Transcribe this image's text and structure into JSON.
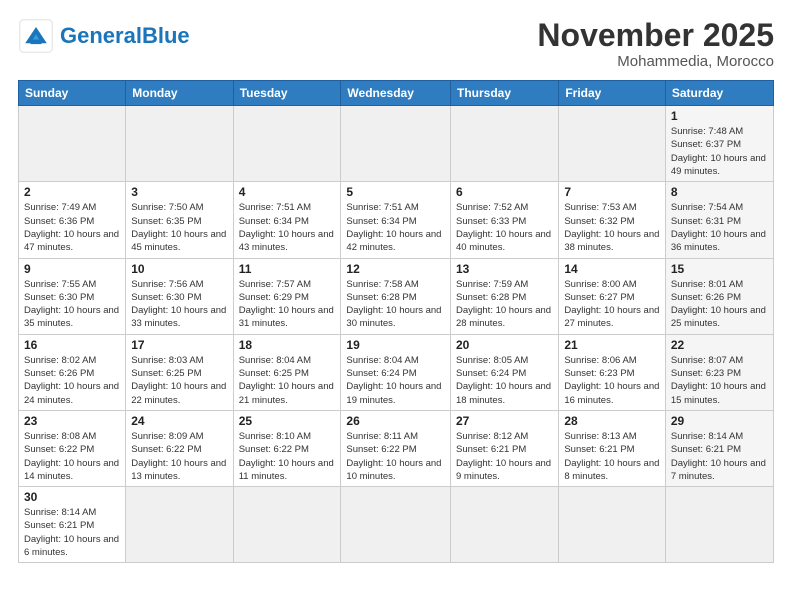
{
  "header": {
    "logo_general": "General",
    "logo_blue": "Blue",
    "month": "November 2025",
    "location": "Mohammedia, Morocco"
  },
  "days_of_week": [
    "Sunday",
    "Monday",
    "Tuesday",
    "Wednesday",
    "Thursday",
    "Friday",
    "Saturday"
  ],
  "weeks": [
    [
      {
        "num": "",
        "info": "",
        "empty": true
      },
      {
        "num": "",
        "info": "",
        "empty": true
      },
      {
        "num": "",
        "info": "",
        "empty": true
      },
      {
        "num": "",
        "info": "",
        "empty": true
      },
      {
        "num": "",
        "info": "",
        "empty": true
      },
      {
        "num": "",
        "info": "",
        "empty": true
      },
      {
        "num": "1",
        "info": "Sunrise: 7:48 AM\nSunset: 6:37 PM\nDaylight: 10 hours\nand 49 minutes.",
        "shaded": true
      }
    ],
    [
      {
        "num": "2",
        "info": "Sunrise: 7:49 AM\nSunset: 6:36 PM\nDaylight: 10 hours\nand 47 minutes."
      },
      {
        "num": "3",
        "info": "Sunrise: 7:50 AM\nSunset: 6:35 PM\nDaylight: 10 hours\nand 45 minutes."
      },
      {
        "num": "4",
        "info": "Sunrise: 7:51 AM\nSunset: 6:34 PM\nDaylight: 10 hours\nand 43 minutes."
      },
      {
        "num": "5",
        "info": "Sunrise: 7:51 AM\nSunset: 6:34 PM\nDaylight: 10 hours\nand 42 minutes."
      },
      {
        "num": "6",
        "info": "Sunrise: 7:52 AM\nSunset: 6:33 PM\nDaylight: 10 hours\nand 40 minutes."
      },
      {
        "num": "7",
        "info": "Sunrise: 7:53 AM\nSunset: 6:32 PM\nDaylight: 10 hours\nand 38 minutes."
      },
      {
        "num": "8",
        "info": "Sunrise: 7:54 AM\nSunset: 6:31 PM\nDaylight: 10 hours\nand 36 minutes.",
        "shaded": true
      }
    ],
    [
      {
        "num": "9",
        "info": "Sunrise: 7:55 AM\nSunset: 6:30 PM\nDaylight: 10 hours\nand 35 minutes."
      },
      {
        "num": "10",
        "info": "Sunrise: 7:56 AM\nSunset: 6:30 PM\nDaylight: 10 hours\nand 33 minutes."
      },
      {
        "num": "11",
        "info": "Sunrise: 7:57 AM\nSunset: 6:29 PM\nDaylight: 10 hours\nand 31 minutes."
      },
      {
        "num": "12",
        "info": "Sunrise: 7:58 AM\nSunset: 6:28 PM\nDaylight: 10 hours\nand 30 minutes."
      },
      {
        "num": "13",
        "info": "Sunrise: 7:59 AM\nSunset: 6:28 PM\nDaylight: 10 hours\nand 28 minutes."
      },
      {
        "num": "14",
        "info": "Sunrise: 8:00 AM\nSunset: 6:27 PM\nDaylight: 10 hours\nand 27 minutes."
      },
      {
        "num": "15",
        "info": "Sunrise: 8:01 AM\nSunset: 6:26 PM\nDaylight: 10 hours\nand 25 minutes.",
        "shaded": true
      }
    ],
    [
      {
        "num": "16",
        "info": "Sunrise: 8:02 AM\nSunset: 6:26 PM\nDaylight: 10 hours\nand 24 minutes."
      },
      {
        "num": "17",
        "info": "Sunrise: 8:03 AM\nSunset: 6:25 PM\nDaylight: 10 hours\nand 22 minutes."
      },
      {
        "num": "18",
        "info": "Sunrise: 8:04 AM\nSunset: 6:25 PM\nDaylight: 10 hours\nand 21 minutes."
      },
      {
        "num": "19",
        "info": "Sunrise: 8:04 AM\nSunset: 6:24 PM\nDaylight: 10 hours\nand 19 minutes."
      },
      {
        "num": "20",
        "info": "Sunrise: 8:05 AM\nSunset: 6:24 PM\nDaylight: 10 hours\nand 18 minutes."
      },
      {
        "num": "21",
        "info": "Sunrise: 8:06 AM\nSunset: 6:23 PM\nDaylight: 10 hours\nand 16 minutes."
      },
      {
        "num": "22",
        "info": "Sunrise: 8:07 AM\nSunset: 6:23 PM\nDaylight: 10 hours\nand 15 minutes.",
        "shaded": true
      }
    ],
    [
      {
        "num": "23",
        "info": "Sunrise: 8:08 AM\nSunset: 6:22 PM\nDaylight: 10 hours\nand 14 minutes."
      },
      {
        "num": "24",
        "info": "Sunrise: 8:09 AM\nSunset: 6:22 PM\nDaylight: 10 hours\nand 13 minutes."
      },
      {
        "num": "25",
        "info": "Sunrise: 8:10 AM\nSunset: 6:22 PM\nDaylight: 10 hours\nand 11 minutes."
      },
      {
        "num": "26",
        "info": "Sunrise: 8:11 AM\nSunset: 6:22 PM\nDaylight: 10 hours\nand 10 minutes."
      },
      {
        "num": "27",
        "info": "Sunrise: 8:12 AM\nSunset: 6:21 PM\nDaylight: 10 hours\nand 9 minutes."
      },
      {
        "num": "28",
        "info": "Sunrise: 8:13 AM\nSunset: 6:21 PM\nDaylight: 10 hours\nand 8 minutes."
      },
      {
        "num": "29",
        "info": "Sunrise: 8:14 AM\nSunset: 6:21 PM\nDaylight: 10 hours\nand 7 minutes.",
        "shaded": true
      }
    ],
    [
      {
        "num": "30",
        "info": "Sunrise: 8:14 AM\nSunset: 6:21 PM\nDaylight: 10 hours\nand 6 minutes."
      },
      {
        "num": "",
        "info": "",
        "empty": true
      },
      {
        "num": "",
        "info": "",
        "empty": true
      },
      {
        "num": "",
        "info": "",
        "empty": true
      },
      {
        "num": "",
        "info": "",
        "empty": true
      },
      {
        "num": "",
        "info": "",
        "empty": true
      },
      {
        "num": "",
        "info": "",
        "empty": true
      }
    ]
  ]
}
